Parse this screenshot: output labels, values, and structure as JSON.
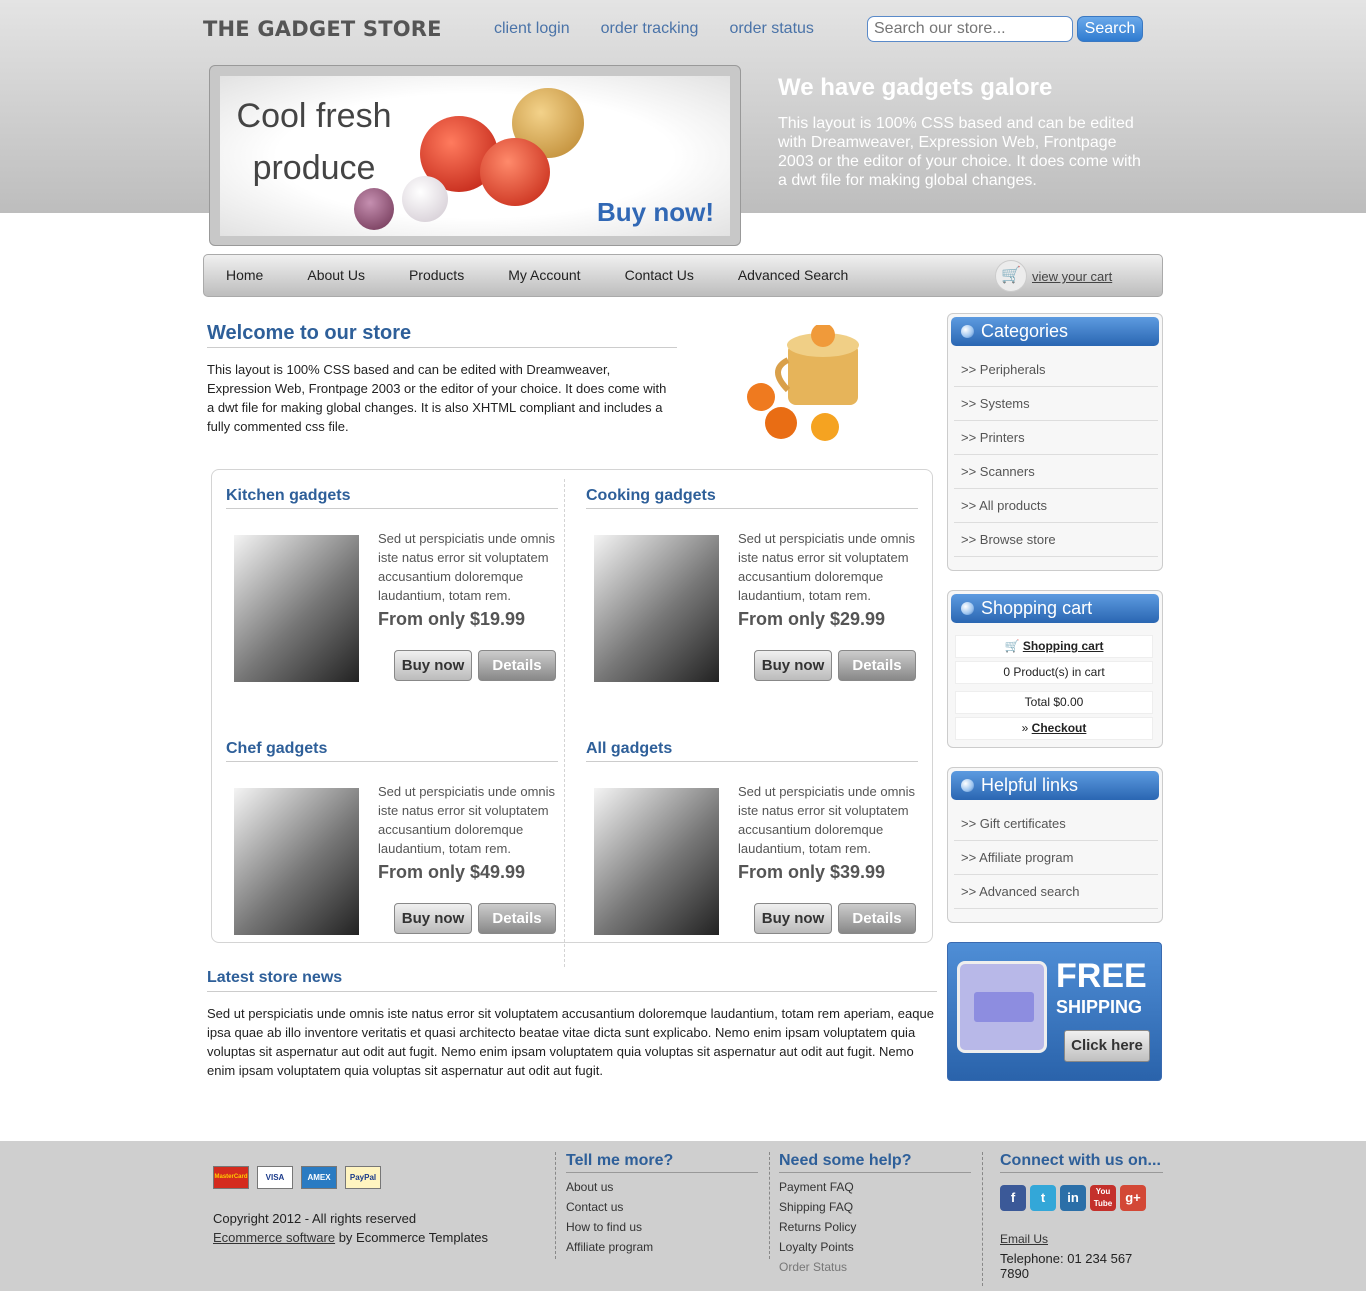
{
  "header": {
    "logo": "THE GADGET STORE",
    "links": [
      "client login",
      "order tracking",
      "order status"
    ],
    "search_placeholder": "Search our store...",
    "search_button": "Search"
  },
  "banner": {
    "headline_line1": "Cool fresh",
    "headline_line2": "produce",
    "cta": "Buy now!"
  },
  "intro": {
    "title": "We have gadgets galore",
    "text": "This layout is 100% CSS based and can be edited with Dreamweaver, Expression Web, Frontpage 2003 or the editor of your choice. It does come with a dwt file for making global changes."
  },
  "nav": {
    "items": [
      "Home",
      "About Us",
      "Products",
      "My Account",
      "Contact Us",
      "Advanced Search"
    ],
    "cart_link": "view your cart"
  },
  "welcome": {
    "title": "Welcome to our store",
    "text": "This layout is 100% CSS based and can be edited with Dreamweaver, Expression Web, Frontpage 2003 or the editor of your choice. It does come with a dwt file for making global changes. It is also XHTML compliant and includes a fully commented css file."
  },
  "products": [
    {
      "title": "Kitchen gadgets",
      "text": "Sed ut perspiciatis unde omnis iste natus error sit voluptatem accusantium doloremque laudantium, totam rem.",
      "price": "From only $19.99",
      "buy": "Buy now",
      "details": "Details"
    },
    {
      "title": "Cooking gadgets",
      "text": "Sed ut perspiciatis unde omnis iste natus error sit voluptatem accusantium doloremque laudantium, totam rem.",
      "price": "From only $29.99",
      "buy": "Buy now",
      "details": "Details"
    },
    {
      "title": "Chef gadgets",
      "text": "Sed ut perspiciatis unde omnis iste natus error sit voluptatem accusantium doloremque laudantium, totam rem.",
      "price": "From only $49.99",
      "buy": "Buy now",
      "details": "Details"
    },
    {
      "title": "All gadgets",
      "text": "Sed ut perspiciatis unde omnis iste natus error sit voluptatem accusantium doloremque laudantium, totam rem.",
      "price": "From only $39.99",
      "buy": "Buy now",
      "details": "Details"
    }
  ],
  "news": {
    "title": "Latest store news",
    "text": "Sed ut perspiciatis unde omnis iste natus error sit voluptatem accusantium doloremque laudantium, totam rem aperiam, eaque ipsa quae ab illo inventore veritatis et quasi architecto beatae vitae dicta sunt explicabo. Nemo enim ipsam voluptatem quia voluptas sit aspernatur aut odit aut fugit. Nemo enim ipsam voluptatem quia voluptas sit aspernatur aut odit aut fugit. Nemo enim ipsam voluptatem quia voluptas sit aspernatur aut odit aut fugit."
  },
  "categories": {
    "title": "Categories",
    "items": [
      ">> Peripherals",
      ">> Systems",
      ">> Printers",
      ">> Scanners",
      ">> All products",
      ">> Browse store"
    ]
  },
  "cart": {
    "title": "Shopping cart",
    "link": "Shopping cart",
    "count": "0 Product(s) in cart",
    "total": "Total $0.00",
    "checkout_prefix": "»",
    "checkout": "Checkout"
  },
  "helpful": {
    "title": "Helpful links",
    "items": [
      ">> Gift certificates",
      ">> Affiliate program",
      ">> Advanced search"
    ]
  },
  "promo": {
    "line1": "FREE",
    "line2": "SHIPPING",
    "button": "Click here"
  },
  "footer": {
    "cards": [
      "MasterCard",
      "VISA",
      "AMEX",
      "PayPal"
    ],
    "copyright": "Copyright 2012 - All rights reserved",
    "software_link": "Ecommerce software",
    "by_text": " by Ecommerce Templates",
    "col1": {
      "title": "Tell me more?",
      "links": [
        "About us",
        "Contact us",
        "How to find us",
        "Affiliate program"
      ]
    },
    "col2": {
      "title": "Need some help?",
      "links": [
        "Payment FAQ",
        "Shipping FAQ",
        "Returns Policy",
        "Loyalty Points",
        "Order Status"
      ]
    },
    "col3": {
      "title": "Connect with us on...",
      "social": [
        "f",
        "t",
        "in",
        "You Tube",
        "g+"
      ],
      "email": "Email Us",
      "telephone": "Telephone: 01 234 567 7890"
    }
  }
}
